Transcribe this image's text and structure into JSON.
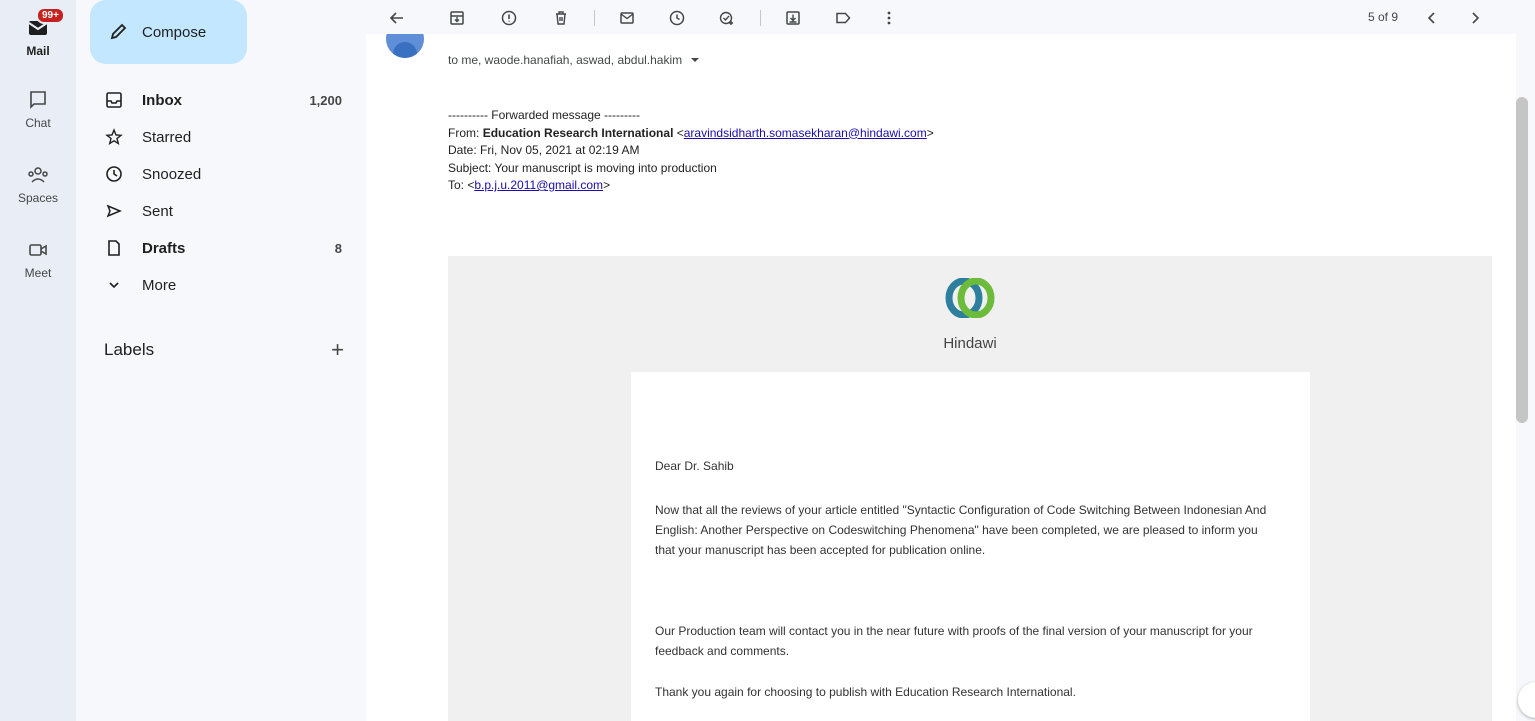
{
  "rail": {
    "mail_badge": "99+",
    "items": [
      {
        "label": "Mail",
        "icon": "mail-icon"
      },
      {
        "label": "Chat",
        "icon": "chat-icon"
      },
      {
        "label": "Spaces",
        "icon": "spaces-icon"
      },
      {
        "label": "Meet",
        "icon": "meet-icon"
      }
    ]
  },
  "nav": {
    "compose_label": "Compose",
    "items": [
      {
        "label": "Inbox",
        "count": "1,200",
        "icon": "inbox-icon"
      },
      {
        "label": "Starred",
        "count": "",
        "icon": "star-icon"
      },
      {
        "label": "Snoozed",
        "count": "",
        "icon": "clock-icon"
      },
      {
        "label": "Sent",
        "count": "",
        "icon": "send-icon"
      },
      {
        "label": "Drafts",
        "count": "8",
        "icon": "draft-icon"
      },
      {
        "label": "More",
        "count": "",
        "icon": "chevron-down-icon"
      }
    ],
    "labels_heading": "Labels",
    "labels_add": "+"
  },
  "toolbar": {
    "pager": "5 of 9"
  },
  "message": {
    "recipients": "to me, waode.hanafiah, aswad, abdul.hakim",
    "forward_header": "---------- Forwarded message ---------",
    "from_label": "From:",
    "from_name": "Education Research International",
    "from_email": "aravindsidharth.somasekharan@hindawi.com",
    "date_line": "Date: Fri, Nov 05, 2021 at 02:19 AM",
    "subject_line": "Subject: Your manuscript is moving into production",
    "to_label": "To:",
    "to_email": "b.p.j.u.2011@gmail.com",
    "brand": "Hindawi",
    "greeting": "Dear Dr. Sahib",
    "para1": "Now that all the reviews of your article entitled \"Syntactic Configuration of Code Switching Between Indonesian And English: Another Perspective on Codeswitching Phenomena\" have been completed, we are pleased to inform you that your manuscript has been accepted for publication online.",
    "para2": "Our Production team will contact you in the near future with proofs of the final version of your manuscript for your feedback and comments.",
    "para3": "Thank you again for choosing to publish with Education Research International."
  },
  "colors": {
    "accent": "#c2e7ff",
    "badge": "#c5221f",
    "link": "#1a0dab"
  }
}
